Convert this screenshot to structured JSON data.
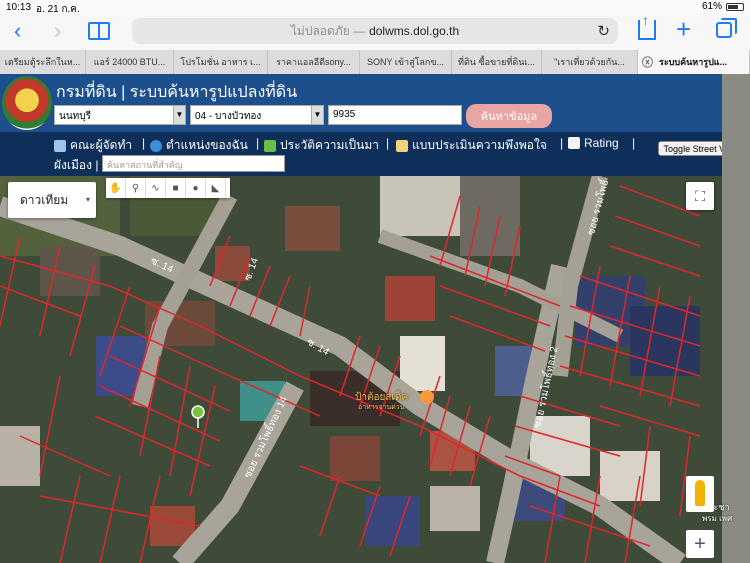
{
  "status": {
    "time": "10:13",
    "date": "อ. 21 ก.ค.",
    "battery": "61%"
  },
  "browser": {
    "insecure_label": "ไม่ปลอดภัย —",
    "domain": "dolwms.dol.go.th",
    "reload": "↻",
    "back": "‹",
    "forward": "›",
    "tabs": [
      "เตรียมตู้ระลึกในห...",
      "แอร์ 24000 BTU...",
      "โปรโมชั่น อาหาร เ...",
      "ราคาแอลอีดีsony...",
      "SONY เข้าสู่โลกข...",
      "ที่ดิน ซื้อขายที่ดินเ...",
      "\"เราเที่ยวด้วยกัน...",
      "ระบบค้นหารูปแ..."
    ],
    "tab_close": "ⓧ"
  },
  "header": {
    "title": "กรมที่ดิน | ระบบค้นหารูปแปลงที่ดิน",
    "province": "นนทบุรี",
    "amphoe": "04 - บางบัวทอง",
    "parcel_no": "9935",
    "search_label": "ค้นหาข้อมูล"
  },
  "menu": {
    "items": [
      "คณะผู้จัดทำ",
      "ตำแหน่งของฉัน",
      "ประวัติความเป็นมา",
      "แบบประเมินความพึงพอใจ",
      "Rating"
    ],
    "separator": "|",
    "street_view": "Toggle Street View",
    "city_label": "ผังเมือง",
    "place_placeholder": "ค้นหาสถานที่สำคัญ"
  },
  "map": {
    "type_label": "ดาวเทียม",
    "caret": "▾",
    "fullscreen": "⛶",
    "zoom_in": "+",
    "poi_name": "ป้าต้อยสเต็ค",
    "poi_sub": "อาหารจานด่วน",
    "road_labels": [
      "ซ. 14",
      "ซ. 14",
      "ซ. 14",
      "ซอย รวมโพธิ์ทอง 14",
      "ซอย รวมโพธิ์ทอง 2",
      "ซอย รวมโพธิ์"
    ],
    "corner_text": [
      "ประชา",
      "พรม เพศ"
    ]
  },
  "colors": {
    "header": "#1d4f8c",
    "menu": "#0e2f5a",
    "parcel_line": "#e0262a",
    "search_btn": "#e9a4a4"
  }
}
